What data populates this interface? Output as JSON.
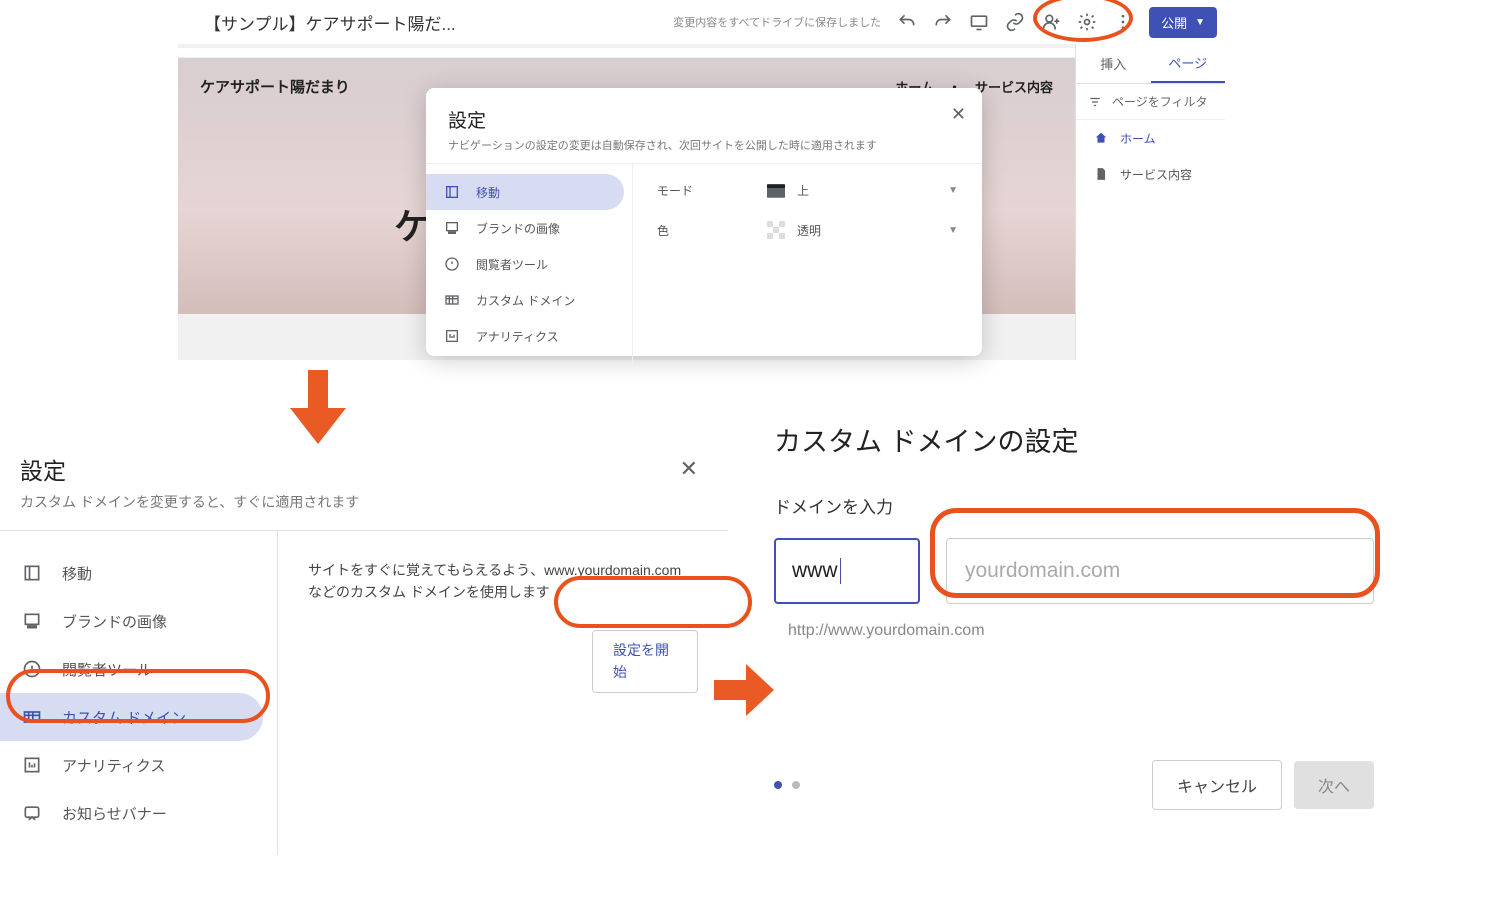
{
  "top": {
    "doc_title": "【サンプル】ケアサポート陽だ...",
    "save_status": "変更内容をすべてドライブに保存しました",
    "publish": "公開",
    "hero": {
      "brand": "ケアサポート陽だまり",
      "nav_home": "ホーム",
      "nav_dot": "・",
      "nav_service": "サービス内容",
      "title_fragment": "ケ"
    },
    "dialog": {
      "title": "設定",
      "sub": "ナビゲーションの設定の変更は自動保存され、次回サイトを公開した時に適用されます",
      "items": [
        "移動",
        "ブランドの画像",
        "閲覧者ツール",
        "カスタム ドメイン",
        "アナリティクス"
      ],
      "row1_label": "モード",
      "row1_value": "上",
      "row2_label": "色",
      "row2_value": "透明"
    },
    "rpanel": {
      "tab1": "挿入",
      "tab2": "ページ",
      "filter": "ページをフィルタ",
      "item1": "ホーム",
      "item2": "サービス内容"
    }
  },
  "bl": {
    "title": "設定",
    "sub": "カスタム ドメインを変更すると、すぐに適用されます",
    "items": [
      "移動",
      "ブランドの画像",
      "閲覧者ツール",
      "カスタム ドメイン",
      "アナリティクス",
      "お知らせバナー"
    ],
    "desc": "サイトをすぐに覚えてもらえるよう、www.yourdomain.com などのカスタム ドメインを使用します",
    "start": "設定を開始"
  },
  "br": {
    "title": "カスタム ドメインの設定",
    "label": "ドメインを入力",
    "input1": "www",
    "input2_placeholder": "yourdomain.com",
    "url": "http://www.yourdomain.com",
    "cancel": "キャンセル",
    "next": "次へ"
  }
}
